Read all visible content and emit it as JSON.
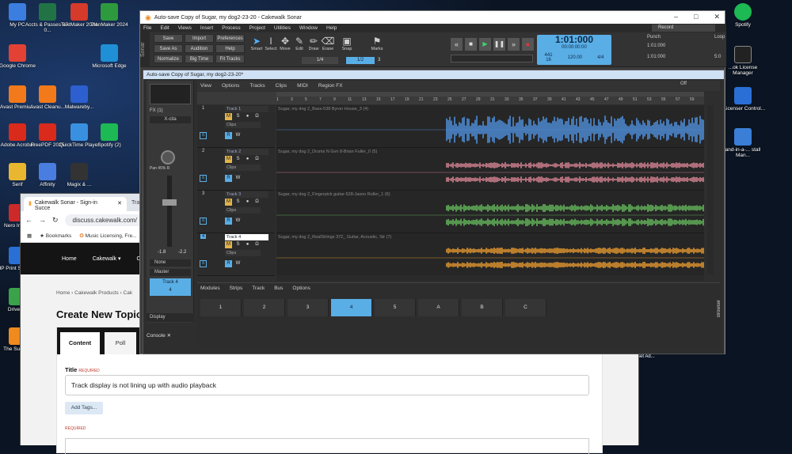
{
  "desktop": {
    "icons_left": [
      {
        "label": "My PC",
        "color": "#3b7ee0"
      },
      {
        "label": "Google Chrome",
        "color": "#e34133"
      },
      {
        "label": "Avast Premiu...",
        "color": "#f27a1a"
      },
      {
        "label": "Adobe Acrobat",
        "color": "#d92a1c"
      },
      {
        "label": "Serif",
        "color": "#e8b72f"
      },
      {
        "label": "Nero Image",
        "color": "#cc2a2a"
      },
      {
        "label": "HP Print Scan Do",
        "color": "#2a6fd6"
      },
      {
        "label": "Driver G",
        "color": "#3aa34a"
      },
      {
        "label": "The Superm",
        "color": "#f08a1e"
      }
    ],
    "icons_col2": [
      {
        "label": "Accts & Passes 07-0...",
        "color": "#217346"
      },
      {
        "label": "Avast Cleanu...",
        "color": "#f27a1a"
      },
      {
        "label": "FreePDF 2025",
        "color": "#d92a1c"
      },
      {
        "label": "Affinity",
        "color": "#4a7de0"
      }
    ],
    "icons_col3": [
      {
        "label": "TextMaker 2024",
        "color": "#d63a2a"
      },
      {
        "label": "Malwareby...",
        "color": "#2d5fd0"
      },
      {
        "label": "QuickTime Player",
        "color": "#3a90e0"
      },
      {
        "label": "Magix & ...",
        "color": "#333"
      }
    ],
    "icons_col4": [
      {
        "label": "PlanMaker 2024",
        "color": "#2e9a3e"
      },
      {
        "label": "Microsoft Edge",
        "color": "#1f8fd6"
      },
      {
        "label": "Spotify (2)",
        "color": "#1db954"
      }
    ],
    "icons_right": [
      {
        "label": "Spotify",
        "color": "#1db954"
      },
      {
        "label": "...ok License Manager",
        "color": "#ddd"
      },
      {
        "label": "eLicenser Control...",
        "color": "#2a6fd6"
      },
      {
        "label": "and-in-a-... stall Man...",
        "color": "#3a7ed8"
      }
    ],
    "partial_labels": {
      "presen": "Presen",
      "num20": "20",
      "setad": "Set Ad..."
    }
  },
  "browser": {
    "tab_title": "Cakewalk Sonar - Sign-in Succe",
    "tab2": "Tra",
    "url": "discuss.cakewalk.com/",
    "bookmarks_label": "Bookmarks",
    "bookmark1": "Music Licensing, Fre...",
    "nav": {
      "home": "Home",
      "cakewalk": "Cakewalk ▾",
      "other": "Ot"
    },
    "breadcrumb": {
      "home": "Home",
      "products": "Cakewalk Products",
      "more": "Cak"
    },
    "heading": "Create New Topic",
    "tabs": {
      "content": "Content",
      "poll": "Poll"
    },
    "title_label": "Title",
    "required": "REQUIRED",
    "title_value": "Track display is not lining up with audio playback",
    "add_tags": "Add Tags...",
    "required2": "REQUIRED"
  },
  "sonar": {
    "window_title": "Auto-save Copy of Sugar, my dog2-23-20 - Cakewalk Sonar",
    "brand": "Sonar",
    "menu": [
      "File",
      "Edit",
      "Views",
      "Insert",
      "Process",
      "Project",
      "Utilities",
      "Window",
      "Help"
    ],
    "record_label": "Record",
    "buttons": {
      "save": "Save",
      "import": "Import",
      "preferences": "Preferences",
      "saveas": "Save As",
      "audition": "Audition",
      "help": "Help",
      "normalize": "Normalize",
      "bigtime": "Big Time",
      "fittracks": "Fit Tracks"
    },
    "tools": [
      "Smart",
      "Select",
      "Move",
      "Edit",
      "Draw",
      "Erase"
    ],
    "snap": "Snap",
    "marks": "Marks",
    "snap_val": "1/4",
    "snap_val2": "1/2",
    "snap_val3": "3",
    "lcd": {
      "time": "1:01:000",
      "smpte": "00:00:00:00",
      "bpm_top": "441",
      "bpm_bot": "16",
      "tempo": "120.00",
      "meter": "4/4"
    },
    "punch": "Punch",
    "punch_from": "1:01:000",
    "punch_to": "1:01:000",
    "loop": "Loop",
    "loop_val": "5:0",
    "doc_title": "Auto-save Copy of Sugar, my dog2-23-20*",
    "track_menu": [
      "View",
      "Options",
      "Tracks",
      "Clips",
      "MIDI",
      "Region FX"
    ],
    "off": "Off",
    "ruler": [
      "1",
      "3",
      "5",
      "7",
      "9",
      "11",
      "13",
      "15",
      "17",
      "19",
      "21",
      "23",
      "25",
      "27",
      "29",
      "31",
      "33",
      "35",
      "37",
      "39",
      "41",
      "43",
      "45",
      "47",
      "49",
      "51",
      "53",
      "55",
      "57",
      "59"
    ],
    "inspector": {
      "fx": "FX (1)",
      "xcita": "X-cita",
      "pan": "Pan 45% R",
      "db1": "-1.8",
      "db2": "-2.2",
      "none": "None",
      "master": "Master",
      "track": "Track 4",
      "num": "4",
      "display": "Display"
    },
    "tracks": [
      {
        "num": "1",
        "name": "Track 1",
        "clip": "Sugar, my dog 2_Bass-538 Byron House_3 (4)",
        "color": "#4f8ed8"
      },
      {
        "num": "2",
        "name": "Track 2",
        "clip": "Sugar, my dog 2_Drums N Gvn 8-Brian Fuller_0 (5)",
        "color": "#d08090"
      },
      {
        "num": "3",
        "name": "Track 3",
        "clip": "Sugar, my dog 2_Fingerpick guitar-528-Jason Roller_1 (6)",
        "color": "#63b25a"
      },
      {
        "num": "4",
        "name": "Track 4",
        "clip": "Sugar, my dog 2_RealStrings 372_ Guitar, Acoustic, Str (7)",
        "color": "#e0952f"
      }
    ],
    "clips_label": "Clips",
    "mixer_menu": [
      "Modules",
      "Strips",
      "Track",
      "Bus",
      "Options"
    ],
    "strips": [
      "1",
      "2",
      "3",
      "4",
      "5",
      "A",
      "B",
      "C"
    ],
    "console": "Console",
    "browser_side": "Browser"
  }
}
